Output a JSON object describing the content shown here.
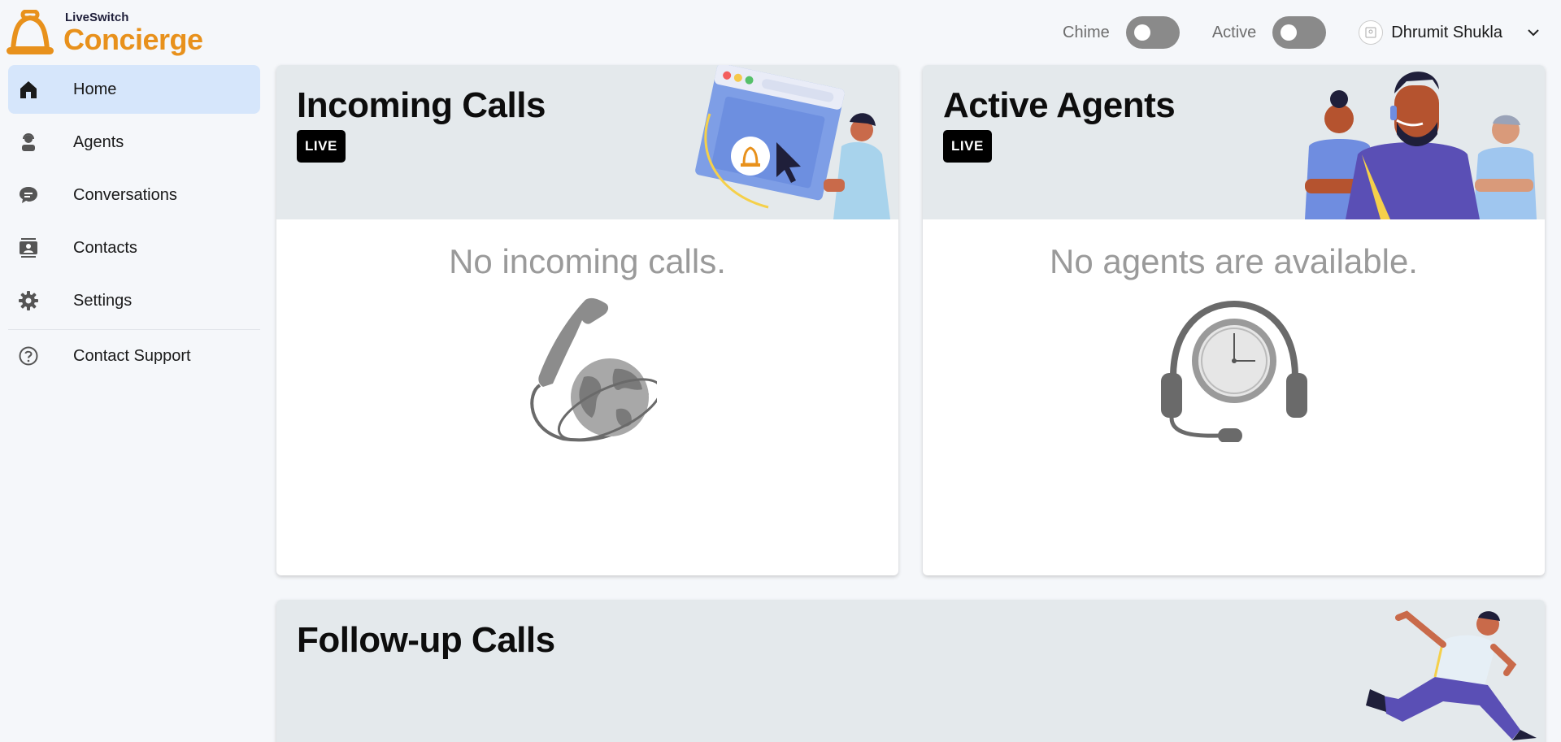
{
  "brand": {
    "top": "LiveSwitch",
    "bottom": "Concierge",
    "accent": "#e8911c"
  },
  "header": {
    "chime_label": "Chime",
    "active_label": "Active",
    "user_name": "Dhrumit Shukla"
  },
  "sidebar": {
    "items": [
      {
        "label": "Home",
        "icon": "home-icon",
        "active": true
      },
      {
        "label": "Agents",
        "icon": "agent-icon"
      },
      {
        "label": "Conversations",
        "icon": "chat-icon"
      },
      {
        "label": "Contacts",
        "icon": "contacts-icon"
      },
      {
        "label": "Settings",
        "icon": "gear-icon"
      }
    ],
    "support": {
      "label": "Contact Support",
      "icon": "help-icon"
    }
  },
  "cards": {
    "incoming": {
      "title": "Incoming Calls",
      "badge": "LIVE",
      "empty": "No incoming calls."
    },
    "agents": {
      "title": "Active Agents",
      "badge": "LIVE",
      "empty": "No agents are available."
    },
    "followup": {
      "title": "Follow-up Calls"
    }
  }
}
